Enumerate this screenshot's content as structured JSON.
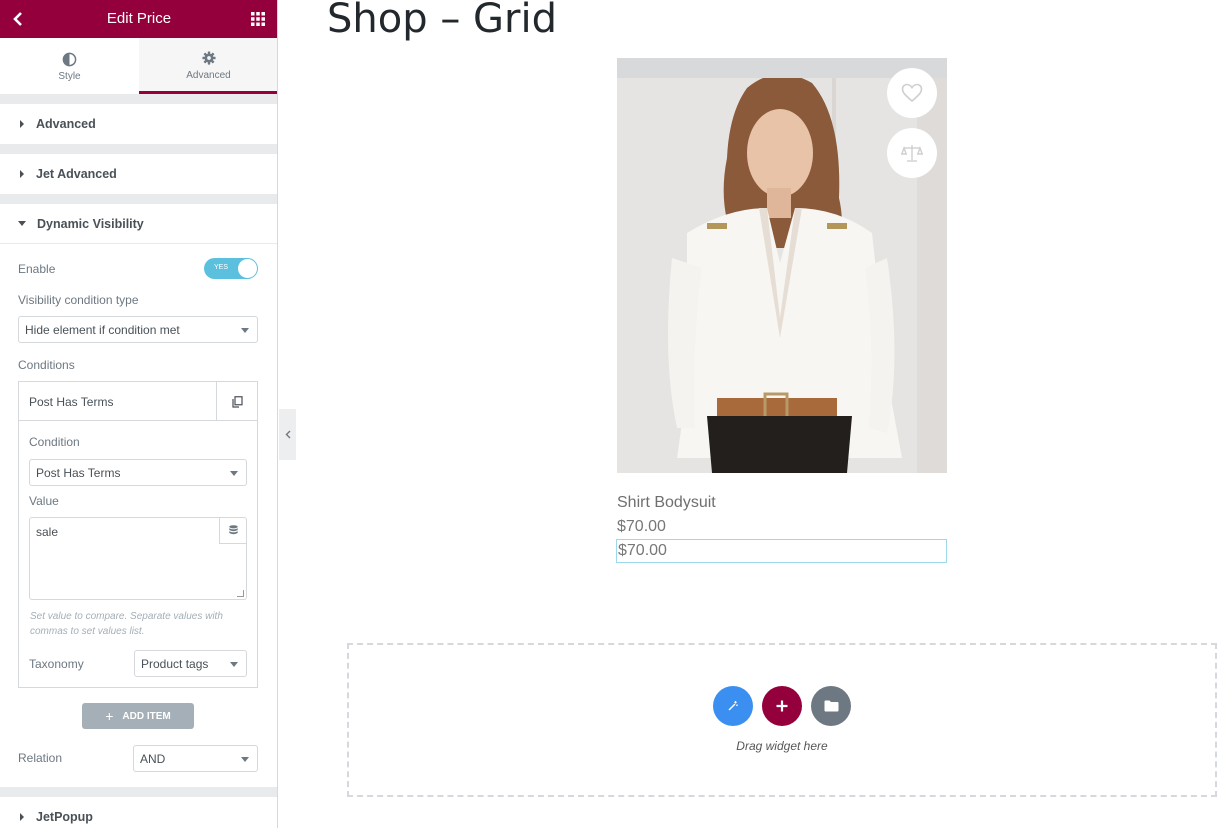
{
  "panel": {
    "title": "Edit Price",
    "tabs": [
      {
        "label": "Style",
        "icon": "half-circle-icon"
      },
      {
        "label": "Advanced",
        "icon": "gear-icon"
      }
    ],
    "sections": {
      "advanced": "Advanced",
      "jet_advanced": "Jet Advanced",
      "dynamic_visibility": "Dynamic Visibility",
      "jetpopup": "JetPopup"
    },
    "dynamic_visibility": {
      "enable_label": "Enable",
      "enable_value": "YES",
      "condition_type_label": "Visibility condition type",
      "condition_type_value": "Hide element if condition met",
      "conditions_label": "Conditions",
      "item": {
        "title": "Post Has Terms",
        "condition_label": "Condition",
        "condition_value": "Post Has Terms",
        "value_label": "Value",
        "value_text": "sale",
        "hint": "Set value to compare. Separate values with commas to set values list.",
        "taxonomy_label": "Taxonomy",
        "taxonomy_value": "Product tags"
      },
      "add_item_label": "ADD ITEM",
      "relation_label": "Relation",
      "relation_value": "AND"
    },
    "accent_color": "#93003c"
  },
  "canvas": {
    "page_title": "Shop – Grid",
    "product": {
      "name": "Shirt Bodysuit",
      "price": "$70.00",
      "price_selected": "$70.00"
    },
    "dropzone": {
      "text": "Drag widget here"
    }
  }
}
